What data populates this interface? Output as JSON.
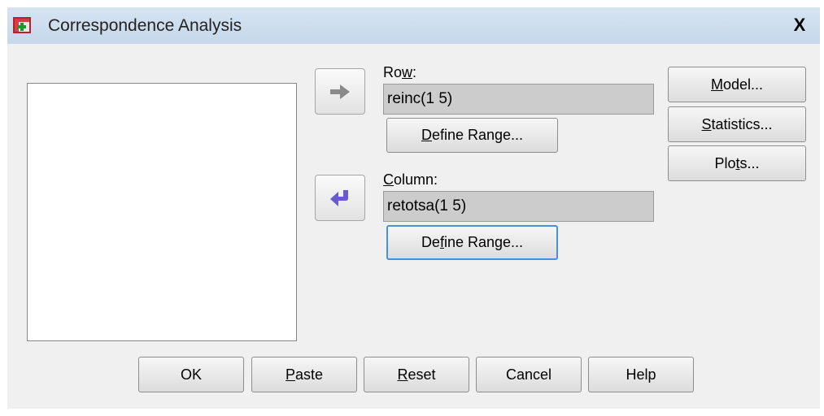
{
  "window": {
    "title": "Correspondence Analysis",
    "close_label": "X"
  },
  "icons": {
    "app": "table-grid-icon",
    "close": "close-icon",
    "move_right": "arrow-right-icon",
    "move_left": "arrow-left-icon"
  },
  "variable_list": {
    "items": []
  },
  "row": {
    "label_pre": "Ro",
    "label_key": "w",
    "label_post": ":",
    "value": "reinc(1 5)"
  },
  "row_define": {
    "pre": "",
    "key": "D",
    "post": "efine Range..."
  },
  "column": {
    "label_pre": "",
    "label_key": "C",
    "label_post": "olumn:",
    "value": "retotsa(1 5)"
  },
  "column_define": {
    "pre": "De",
    "key": "f",
    "post": "ine Range..."
  },
  "side_buttons": {
    "model": {
      "pre": "",
      "key": "M",
      "post": "odel..."
    },
    "statistics": {
      "pre": "",
      "key": "S",
      "post": "tatistics..."
    },
    "plots": {
      "pre": "Plo",
      "key": "t",
      "post": "s..."
    }
  },
  "bottom_buttons": {
    "ok": {
      "pre": "OK",
      "key": "",
      "post": ""
    },
    "paste": {
      "pre": "",
      "key": "P",
      "post": "aste"
    },
    "reset": {
      "pre": "",
      "key": "R",
      "post": "eset"
    },
    "cancel": {
      "pre": "Cancel",
      "key": "",
      "post": ""
    },
    "help": {
      "pre": "Help",
      "key": "",
      "post": ""
    }
  },
  "colors": {
    "titlebar": "#c5d7ea",
    "dialog_bg": "#f0f0f0",
    "field_bg": "#cccccc",
    "arrow_active": "#6a5acd",
    "arrow_inactive": "#8a8a8a"
  }
}
